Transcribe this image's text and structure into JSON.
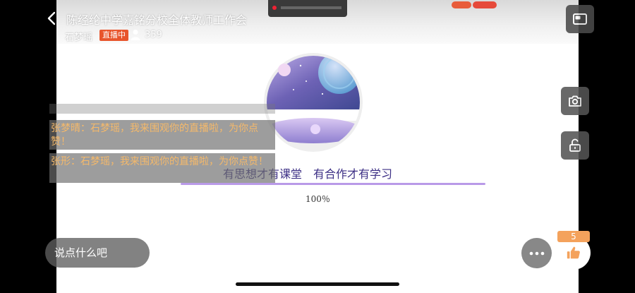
{
  "stream": {
    "title": "陈经纶中学嘉铭分校全体教师工作会",
    "host": "石梦瑶",
    "live_badge": "直播中",
    "viewer_count": "359"
  },
  "content": {
    "slogan": "有思想才有课堂　有合作才有学习",
    "progress": "100％"
  },
  "chat": {
    "messages": [
      {
        "text": "张梦晴：石梦瑶，我来围观你的直播啦，为你点赞！"
      },
      {
        "text": "张形：石梦瑶，我来围观你的直播啦，为你点赞！"
      }
    ]
  },
  "input": {
    "placeholder": "说点什么吧"
  },
  "likes": {
    "count": "5"
  },
  "colors": {
    "live_badge": "#e8552c",
    "chat_text": "#f5b96a",
    "like": "#f4a25c",
    "slogan": "#3c2f85"
  }
}
